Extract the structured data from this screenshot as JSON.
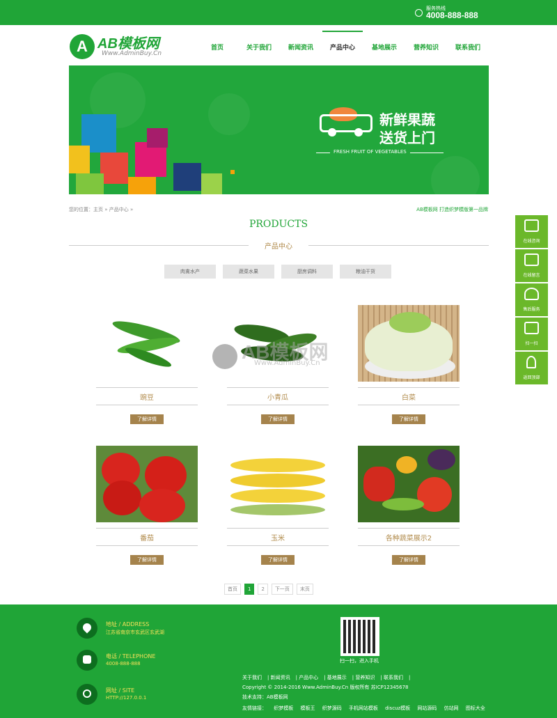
{
  "topbar": {
    "hotline_label": "服务热线",
    "hotline_number": "4008-888-888"
  },
  "logo": {
    "text": "AB模板网",
    "sub": "Www.AdminBuy.Cn"
  },
  "nav": [
    "首页",
    "关于我们",
    "新闻资讯",
    "产品中心",
    "基地展示",
    "营养知识",
    "联系我们"
  ],
  "nav_active": 3,
  "banner": {
    "line1": "新鲜果蔬",
    "line2": "送货上门",
    "en": "FRESH FRUIT OF VEGETABLES"
  },
  "breadcrumb": "您的位置：主页 » 产品中心 »",
  "slogan": "AB模板网 打造织梦模版第一品牌",
  "section": {
    "title_en": "PRODUCTS",
    "title_cn": "产品中心"
  },
  "categories": [
    "肉禽水产",
    "蔬菜水果",
    "厨房调料",
    "粮油干货"
  ],
  "products": [
    {
      "name": "豌豆",
      "btn": "了解详情"
    },
    {
      "name": "小青瓜",
      "btn": "了解详情"
    },
    {
      "name": "白菜",
      "btn": "了解详情"
    },
    {
      "name": "番茄",
      "btn": "了解详情"
    },
    {
      "name": "玉米",
      "btn": "了解详情"
    },
    {
      "name": "各种蔬菜展示2",
      "btn": "了解详情"
    }
  ],
  "watermark": {
    "text": "AB模板网",
    "sub": "Www.AdminBuy.Cn"
  },
  "pager": {
    "first": "首页",
    "p1": "1",
    "p2": "2",
    "next": "下一页",
    "last": "末页"
  },
  "sidebar": [
    "在线咨询",
    "在线留言",
    "售后服务",
    "扫一扫",
    "返回顶部"
  ],
  "footer": {
    "address_title": "地址 / ADDRESS",
    "address": "江苏省南京市玄武区玄武湖",
    "phone_title": "电话 / TELEPHONE",
    "phone": "4008-888-888",
    "site_title": "网址 / SITE",
    "site": "HTTP://127.0.0.1",
    "qr_caption": "扫一扫，进入手机",
    "links": [
      "关于我们",
      "新闻资讯",
      "产品中心",
      "基地展示",
      "营养知识",
      "联系我们"
    ],
    "copyright": "Copyright © 2014-2016 Www.AdminBuy.Cn 版权所有   苏ICP12345678",
    "tech": "技术支持：AB模板网",
    "friends_label": "友情链接：",
    "friends": [
      "织梦模板",
      "模板王",
      "织梦源码",
      "手机网站模板",
      "discuz模板",
      "网站源码",
      "仿站网",
      "图标大全"
    ]
  },
  "colors": {
    "brand_green": "#20a537",
    "button_brown": "#a5834c",
    "sidebar_green": "#6bb82a"
  }
}
